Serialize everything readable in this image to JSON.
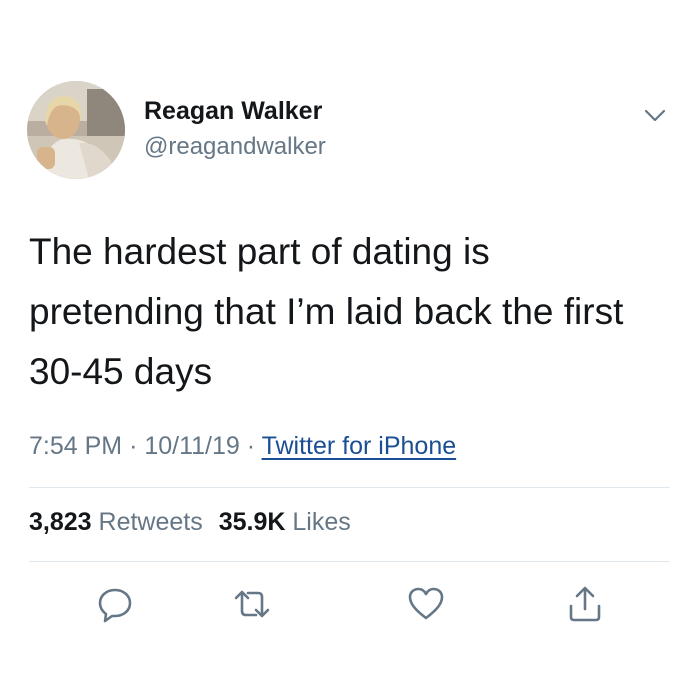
{
  "author": {
    "name": "Reagan Walker",
    "handle": "@reagandwalker",
    "avatar_icon": "profile-photo"
  },
  "tweet": {
    "text_lines": [
      "The hardest part of dating is",
      "pretending that I’m laid back the first",
      "30-45 days"
    ],
    "time": "7:54 PM",
    "date": "10/11/19",
    "separator": "·",
    "source": "Twitter for iPhone"
  },
  "stats": {
    "retweets_count": "3,823",
    "retweets_label": "Retweets",
    "likes_count": "35.9K",
    "likes_label": "Likes"
  },
  "actions": [
    "reply-icon",
    "retweet-icon",
    "like-icon",
    "share-icon"
  ],
  "colors": {
    "text": "#14171a",
    "secondary": "#657786",
    "link": "#1b4f93",
    "icon": "#657786",
    "divider": "#e1e8ed"
  }
}
